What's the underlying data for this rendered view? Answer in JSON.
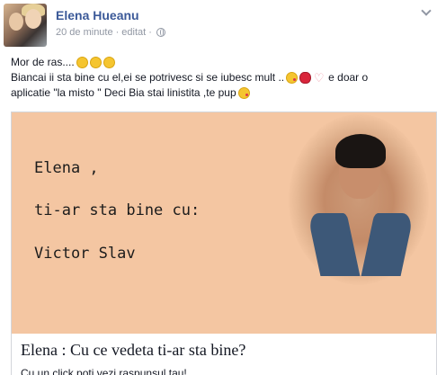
{
  "post": {
    "author": "Elena Hueanu",
    "time": "20 de minute",
    "separator": "·",
    "edited": "editat",
    "audience_icon": "globe-icon",
    "menu_icon": "chevron-down-icon",
    "text_line1": "Mor de ras....",
    "text_line2": "Biancai ii sta bine cu el,ei se potrivesc si se iubesc mult ..",
    "text_line2_tail": "e doar o",
    "text_line3": "aplicatie \"la misto \" Deci Bia stai linistita ,te pup",
    "emoji_names": [
      "laughing-emoji",
      "laughing-emoji",
      "laughing-emoji",
      "kiss-emoji",
      "lips-emoji",
      "heart-emoji",
      "kiss-emoji"
    ]
  },
  "link": {
    "image": {
      "line1": "Elena ,",
      "line2": "ti-ar sta bine cu:",
      "line3": "Victor Slav"
    },
    "title": "Elena : Cu ce vedeta ti-ar sta bine?",
    "description": "Cu un click poti vezi raspunsul tau!"
  },
  "colors": {
    "author": "#3b5998",
    "meta": "#9197a3",
    "card_background": "#f4c6a2"
  }
}
